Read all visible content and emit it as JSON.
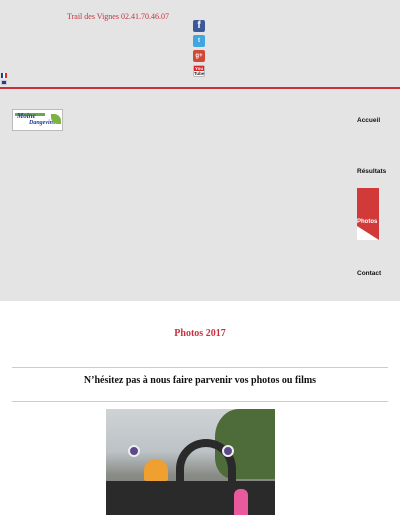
{
  "header": {
    "phone": "Trail des Vignes 02.41.70.46.07",
    "social": [
      {
        "icon": "facebook-icon",
        "glyph": "f"
      },
      {
        "icon": "twitter-icon",
        "glyph": "t"
      },
      {
        "icon": "google-plus-icon",
        "glyph": "g+"
      },
      {
        "icon": "youtube-icon",
        "glyph": "You",
        "glyph2": "Tube"
      }
    ],
    "languages": [
      {
        "icon": "french-flag-icon"
      },
      {
        "icon": "english-flag-icon"
      }
    ],
    "accent_color": "#c8313b"
  },
  "logo": {
    "line1": "Moine",
    "line2": "Dangevins"
  },
  "nav": {
    "items": [
      {
        "label": "Accueil",
        "active": false
      },
      {
        "label": "Résultats",
        "active": false
      },
      {
        "label": "Photos",
        "active": true
      },
      {
        "label": "Contact",
        "active": false
      }
    ]
  },
  "main": {
    "title": "Photos 2017",
    "subtitle": "N’hésitez pas à nous faire parvenir vos photos ou films"
  }
}
